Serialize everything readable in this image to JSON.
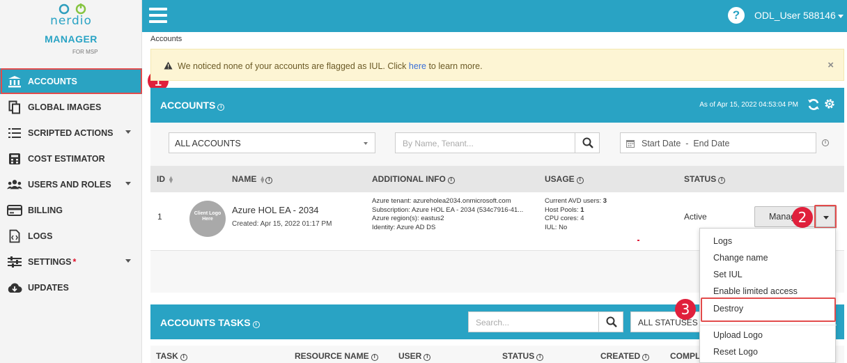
{
  "brand": {
    "name": "nerdio",
    "product": "MANAGER",
    "sub": "FOR MSP",
    "color": "#29a3c4"
  },
  "sidebar": {
    "items": [
      {
        "label": "ACCOUNTS",
        "icon": "bank-icon",
        "active": true
      },
      {
        "label": "GLOBAL IMAGES",
        "icon": "copy-icon"
      },
      {
        "label": "SCRIPTED ACTIONS",
        "icon": "list-icon",
        "expandable": true
      },
      {
        "label": "COST ESTIMATOR",
        "icon": "calculator-icon"
      },
      {
        "label": "USERS AND ROLES",
        "icon": "users-icon",
        "expandable": true
      },
      {
        "label": "BILLING",
        "icon": "credit-card-icon"
      },
      {
        "label": "LOGS",
        "icon": "code-file-icon"
      },
      {
        "label": "SETTINGS",
        "icon": "sliders-icon",
        "expandable": true,
        "flag": "*"
      },
      {
        "label": "UPDATES",
        "icon": "cloud-download-icon"
      }
    ]
  },
  "topbar": {
    "help": "?",
    "user": "ODL_User 588146"
  },
  "breadcrumb": "Accounts",
  "alert": {
    "text_before": "We noticed none of your accounts are flagged as IUL. Click",
    "link": "here",
    "text_after": "to learn more.",
    "close": "×"
  },
  "accounts_panel": {
    "title": "ACCOUNTS",
    "as_of": "As of Apr 15, 2022 04:53:04 PM",
    "filter_value": "ALL ACCOUNTS",
    "search_placeholder": "By Name, Tenant...",
    "date_range": "Start Date  -  End Date",
    "columns": [
      "ID",
      "NAME",
      "ADDITIONAL INFO",
      "USAGE",
      "STATUS"
    ],
    "rows": [
      {
        "id": "1",
        "logo_text": "Client Logo Here",
        "name": "Azure HOL EA - 2034",
        "created": "Created: Apr 15, 2022 01:17 PM",
        "info": [
          "Azure tenant: azureholea2034.onmicrosoft.com",
          "Subscription: Azure HOL EA - 2034 (534c7916-41...",
          "Azure region(s): eastus2",
          "Identity: Azure AD DS"
        ],
        "usage": [
          {
            "label": "Current AVD users:",
            "value": "3"
          },
          {
            "label": "Host Pools:",
            "value": "1"
          },
          {
            "label": "CPU cores:",
            "value": "4"
          },
          {
            "label": "IUL:",
            "value": "No"
          }
        ],
        "status": "Active",
        "action": "Manage"
      }
    ]
  },
  "dropdown_menu": [
    "Logs",
    "Change name",
    "Set IUL",
    "Enable limited access",
    "Destroy",
    "Upload Logo",
    "Reset Logo"
  ],
  "tasks_panel": {
    "title": "ACCOUNTS TASKS",
    "search_placeholder": "Search...",
    "status_filter": "ALL STATUSES",
    "columns": [
      "TASK",
      "RESOURCE NAME",
      "USER",
      "STATUS",
      "CREATED",
      "COMPL"
    ]
  },
  "annotations": [
    "1",
    "2",
    "3"
  ],
  "colors": {
    "accent": "#29a3c4",
    "highlight": "#e24b4b",
    "badge": "#e0203c",
    "alert_bg": "#fdf5d4"
  }
}
